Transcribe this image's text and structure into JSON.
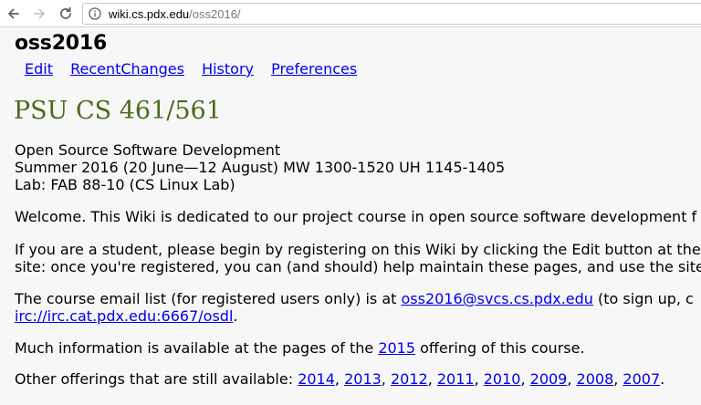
{
  "browser": {
    "url_host": "wiki.cs.pdx.edu",
    "url_path": "/oss2016/"
  },
  "wiki": {
    "name": "oss2016",
    "tabs": [
      "Edit",
      "RecentChanges",
      "History",
      "Preferences"
    ]
  },
  "page": {
    "title": "PSU CS 461/561",
    "info_lines": [
      "Open Source Software Development",
      "Summer 2016 (20 June—12 August) MW 1300-1520 UH 1145-1405",
      "Lab: FAB 88-10 (CS Linux Lab)"
    ],
    "welcome": "Welcome. This Wiki is dedicated to our project course in open source software development f",
    "student_line1": "If you are a student, please begin by registering on this Wiki by clicking the Edit button at the",
    "student_line2": "site: once you're registered, you can (and should) help maintain these pages, and use the site",
    "email_prefix": "The course email list (for registered users only) is at ",
    "email_link": "oss2016@svcs.cs.pdx.edu",
    "email_suffix": " (to sign up, c",
    "irc_link": "irc://irc.cat.pdx.edu:6667/osdl",
    "irc_suffix": ".",
    "much_prefix": "Much information is available at the pages of the ",
    "much_link": "2015",
    "much_suffix": " offering of this course.",
    "other_prefix": "Other offerings that are still available: ",
    "other_years": [
      "2014",
      "2013",
      "2012",
      "2011",
      "2010",
      "2009",
      "2008",
      "2007"
    ],
    "other_suffix": "."
  },
  "icons": {
    "back": "arrow-left-icon",
    "forward": "arrow-right-icon",
    "reload": "reload-icon",
    "info": "info-circle-icon"
  },
  "colors": {
    "title": "#4b6b1a",
    "link": "#0000ee",
    "background": "#f7f7f7"
  }
}
